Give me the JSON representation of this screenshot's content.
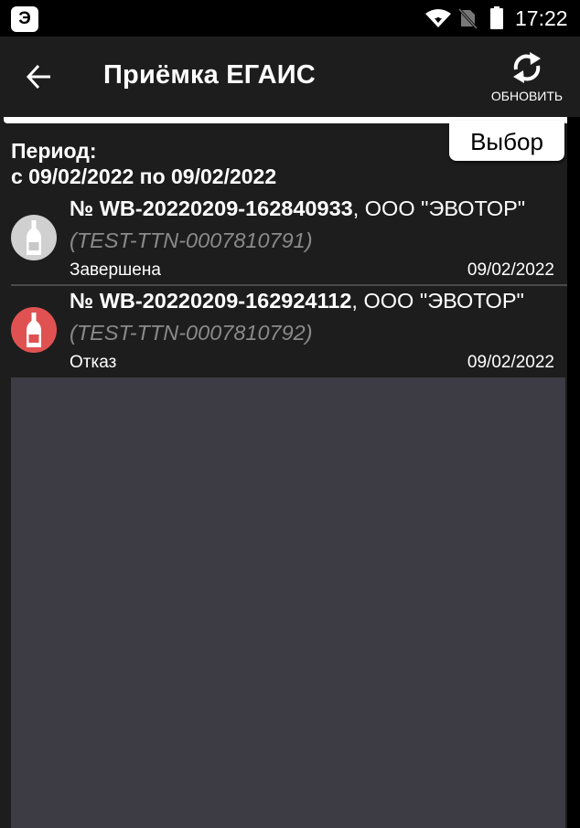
{
  "status_bar": {
    "app_logo": "Э",
    "time": "17:22",
    "icons": [
      "wifi-icon",
      "no-sim-icon",
      "battery-icon"
    ]
  },
  "toolbar": {
    "title": "Приёмка ЕГАИС",
    "back_icon": "arrow-left-icon",
    "refresh_icon": "refresh-icon",
    "refresh_label": "ОБНОВИТЬ"
  },
  "filter": {
    "select_label": "Выбор",
    "period_label": "Период:",
    "period_range": "с 09/02/2022 по 09/02/2022"
  },
  "documents": [
    {
      "number": "№ WB-20220209-162840933",
      "supplier": ", ООО \"ЭВОТОР\"",
      "ttn": "(TEST-TTN-0007810791)",
      "status": "Завершена",
      "date": "09/02/2022",
      "icon": "bottle-icon",
      "icon_color": "#d0d0d0"
    },
    {
      "number": "№ WB-20220209-162924112",
      "supplier": ", ООО \"ЭВОТОР\"",
      "ttn": "(TEST-TTN-0007810792)",
      "status": "Отказ",
      "date": "09/02/2022",
      "icon": "bottle-icon",
      "icon_color": "#e05252"
    }
  ],
  "colors": {
    "background": "#1d1d1d",
    "empty_area": "#3d3c44",
    "secondary_text": "#8a8a8a"
  }
}
